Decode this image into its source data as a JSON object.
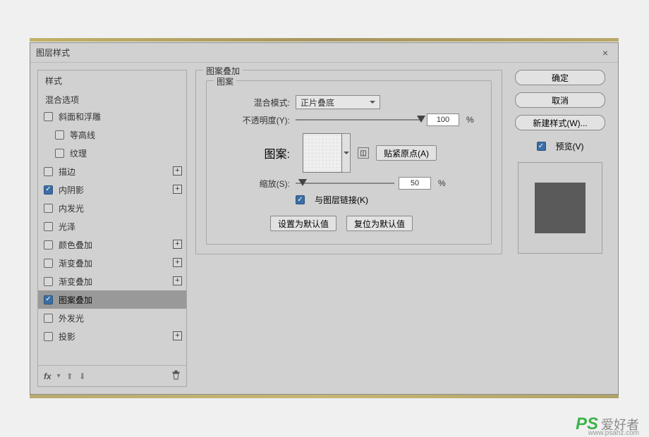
{
  "dialog": {
    "title": "图层样式",
    "close": "×"
  },
  "left": {
    "styles_header": "样式",
    "blend_header": "混合选项",
    "items": [
      {
        "label": "斜面和浮雕",
        "checked": false,
        "plus": false,
        "indent": false
      },
      {
        "label": "等高线",
        "checked": false,
        "plus": false,
        "indent": true
      },
      {
        "label": "纹理",
        "checked": false,
        "plus": false,
        "indent": true
      },
      {
        "label": "描边",
        "checked": false,
        "plus": true,
        "indent": false
      },
      {
        "label": "内阴影",
        "checked": true,
        "plus": true,
        "indent": false
      },
      {
        "label": "内发光",
        "checked": false,
        "plus": false,
        "indent": false
      },
      {
        "label": "光泽",
        "checked": false,
        "plus": false,
        "indent": false
      },
      {
        "label": "颜色叠加",
        "checked": false,
        "plus": true,
        "indent": false
      },
      {
        "label": "渐变叠加",
        "checked": false,
        "plus": true,
        "indent": false
      },
      {
        "label": "渐变叠加",
        "checked": false,
        "plus": true,
        "indent": false
      },
      {
        "label": "图案叠加",
        "checked": true,
        "plus": false,
        "indent": false,
        "selected": true
      },
      {
        "label": "外发光",
        "checked": false,
        "plus": false,
        "indent": false
      },
      {
        "label": "投影",
        "checked": false,
        "plus": true,
        "indent": false
      }
    ],
    "footer_fx": "fx"
  },
  "mid": {
    "outer_title": "图案叠加",
    "inner_title": "图案",
    "blend_mode_label": "混合模式:",
    "blend_mode_value": "正片叠底",
    "opacity_label": "不透明度(Y):",
    "opacity_value": "100",
    "pct": "%",
    "pattern_label": "图案:",
    "snap_btn": "贴紧原点(A)",
    "scale_label": "缩放(S):",
    "scale_value": "50",
    "link_label": "与图层链接(K)",
    "set_default": "设置为默认值",
    "reset_default": "复位为默认值"
  },
  "right": {
    "ok": "确定",
    "cancel": "取消",
    "new_style": "新建样式(W)...",
    "preview": "预览(V)"
  },
  "watermark": {
    "ps": "PS",
    "cn": "爱好者",
    "url": "www.psahz.com"
  }
}
